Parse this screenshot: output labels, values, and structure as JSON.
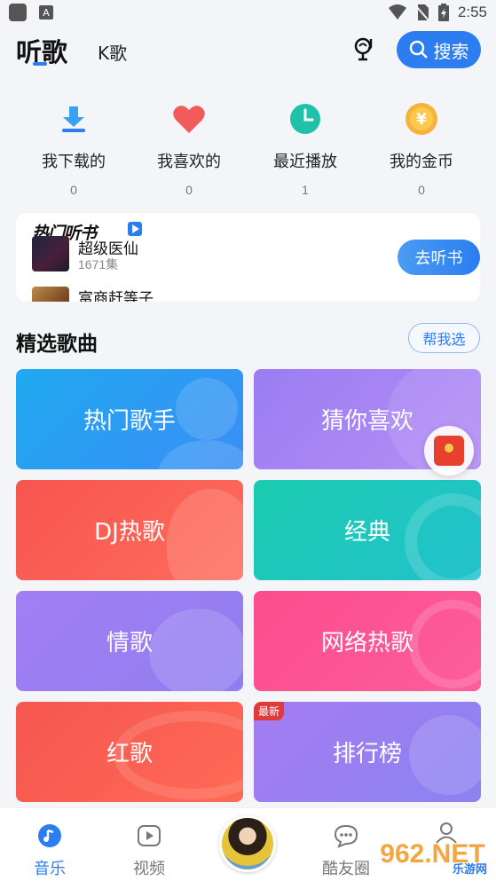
{
  "status_bar": {
    "time": "2:55",
    "notification_letter": "A"
  },
  "header": {
    "tab_listen": "听歌",
    "tab_k": "K歌",
    "search_label": "搜索"
  },
  "quick_items": [
    {
      "label": "我下载的",
      "count": "0",
      "icon": "download-icon"
    },
    {
      "label": "我喜欢的",
      "count": "0",
      "icon": "heart-icon"
    },
    {
      "label": "最近播放",
      "count": "1",
      "icon": "clock-icon"
    },
    {
      "label": "我的金币",
      "count": "0",
      "icon": "coin-icon"
    }
  ],
  "book_card": {
    "banner": "热门听书",
    "title": "超级医仙",
    "episodes": "1671集",
    "next_title": "富商赶等子",
    "button": "去听书"
  },
  "section": {
    "title": "精选歌曲",
    "help_button": "帮我选"
  },
  "tiles": [
    {
      "label": "热门歌手",
      "color_from": "#1fa9f0",
      "color_to": "#3a8ef5"
    },
    {
      "label": "猜你喜欢",
      "color_from": "#9b7df2",
      "color_to": "#b48ef5"
    },
    {
      "label": "DJ热歌",
      "color_from": "#f6554f",
      "color_to": "#ff6c5c"
    },
    {
      "label": "经典",
      "color_from": "#1ccbb0",
      "color_to": "#22c2cc"
    },
    {
      "label": "情歌",
      "color_from": "#a27ef3",
      "color_to": "#8f7ef0"
    },
    {
      "label": "网络热歌",
      "color_from": "#fb4d8c",
      "color_to": "#fd5d9b"
    },
    {
      "label": "红歌",
      "color_from": "#f5564f",
      "color_to": "#ff6a55"
    },
    {
      "label": "排行榜",
      "color_from": "#a57cf2",
      "color_to": "#8b83f0",
      "badge": "最新"
    }
  ],
  "bottom_nav": [
    {
      "label": "音乐",
      "icon": "music-note-icon",
      "active": true
    },
    {
      "label": "视频",
      "icon": "video-play-icon",
      "active": false
    },
    {
      "label": "酷友圈",
      "icon": "chat-bubble-icon",
      "active": false
    }
  ],
  "watermark": {
    "text": "962.NET",
    "sub": "乐游网"
  }
}
